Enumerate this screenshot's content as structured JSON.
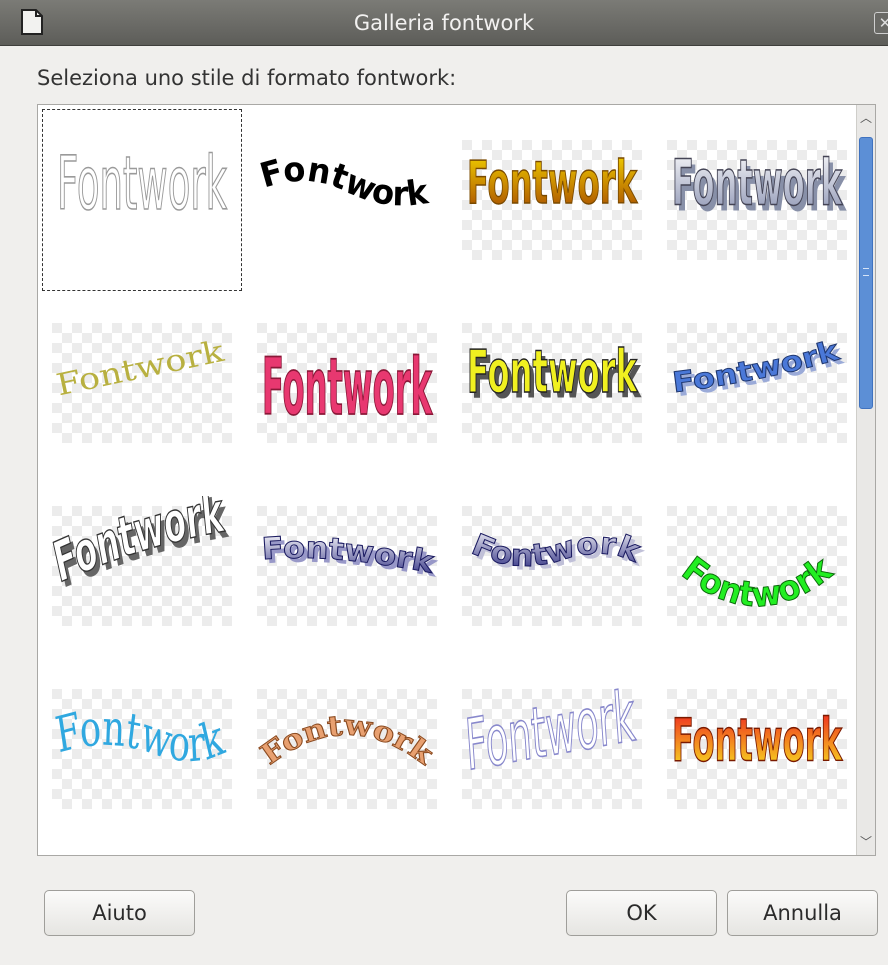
{
  "window": {
    "title": "Galleria fontwork",
    "close_glyph": "✕"
  },
  "prompt": "Seleziona uno stile di formato fontwork:",
  "gallery": {
    "items": [
      {
        "text": "Fontwork",
        "style": "outline-gray",
        "selected": true
      },
      {
        "text": "Fontwork",
        "style": "black-wave"
      },
      {
        "text": "Fontwork",
        "style": "gold-gradient"
      },
      {
        "text": "Fontwork",
        "style": "silver-3d"
      },
      {
        "text": "Fontwork",
        "style": "olive-serif-slant"
      },
      {
        "text": "Fontwork",
        "style": "pink-perspective"
      },
      {
        "text": "Fontwork",
        "style": "yellow-3d"
      },
      {
        "text": "Fontwork",
        "style": "blue-3d-slant"
      },
      {
        "text": "Fontwork",
        "style": "gray-arch-3d"
      },
      {
        "text": "Fontwork",
        "style": "navy-3d"
      },
      {
        "text": "Fontwork",
        "style": "navy-wave-3d"
      },
      {
        "text": "Fontwork",
        "style": "green-arc"
      },
      {
        "text": "Fontwork",
        "style": "cyan-serif-wave"
      },
      {
        "text": "Fontwork",
        "style": "copper-arch"
      },
      {
        "text": "Fontwork",
        "style": "lavender-outline-slant"
      },
      {
        "text": "Fontwork",
        "style": "red-yellow-gradient"
      }
    ]
  },
  "buttons": {
    "help": "Aiuto",
    "ok": "OK",
    "cancel": "Annulla"
  },
  "scrollbar": {
    "up_glyph": "︿",
    "down_glyph": "﹀"
  }
}
